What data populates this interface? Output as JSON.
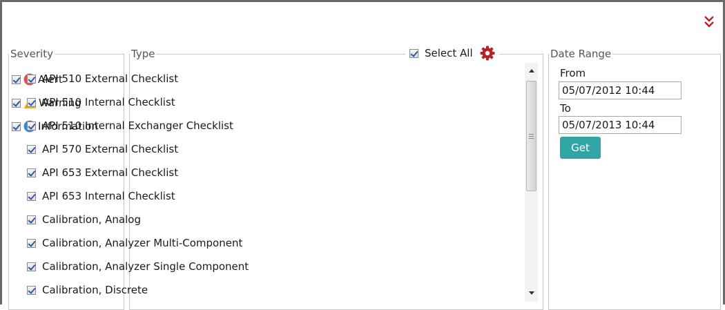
{
  "severity": {
    "legend": "Severity",
    "items": [
      {
        "label": "Alert",
        "checked": true,
        "icon": "alert-icon",
        "color": "#d9534f"
      },
      {
        "label": "Warning",
        "checked": true,
        "icon": "warning-icon",
        "color": "#f0ad1e"
      },
      {
        "label": "Information",
        "checked": true,
        "icon": "info-icon",
        "color": "#3a87d6"
      }
    ]
  },
  "type": {
    "legend": "Type",
    "select_all_label": "Select All",
    "select_all_checked": true,
    "gear_color": "#b5232a",
    "items": [
      {
        "label": "API 510 External Checklist",
        "checked": true
      },
      {
        "label": "API 510 Internal Checklist",
        "checked": true
      },
      {
        "label": "API 510 Internal Exchanger Checklist",
        "checked": true
      },
      {
        "label": "API 570 External Checklist",
        "checked": true
      },
      {
        "label": "API 653 External Checklist",
        "checked": true
      },
      {
        "label": "API 653 Internal Checklist",
        "checked": true
      },
      {
        "label": "Calibration, Analog",
        "checked": true
      },
      {
        "label": "Calibration, Analyzer Multi-Component",
        "checked": true
      },
      {
        "label": "Calibration, Analyzer Single Component",
        "checked": true
      },
      {
        "label": "Calibration, Discrete",
        "checked": true
      }
    ]
  },
  "date_range": {
    "legend": "Date Range",
    "from_label": "From",
    "from_value": "05/07/2012 10:44",
    "to_label": "To",
    "to_value": "05/07/2013 10:44",
    "get_label": "Get",
    "get_color": "#2fa6a5"
  },
  "header": {
    "collapse_icon": "double-chevron-down-icon",
    "collapse_color": "#b5232a"
  }
}
